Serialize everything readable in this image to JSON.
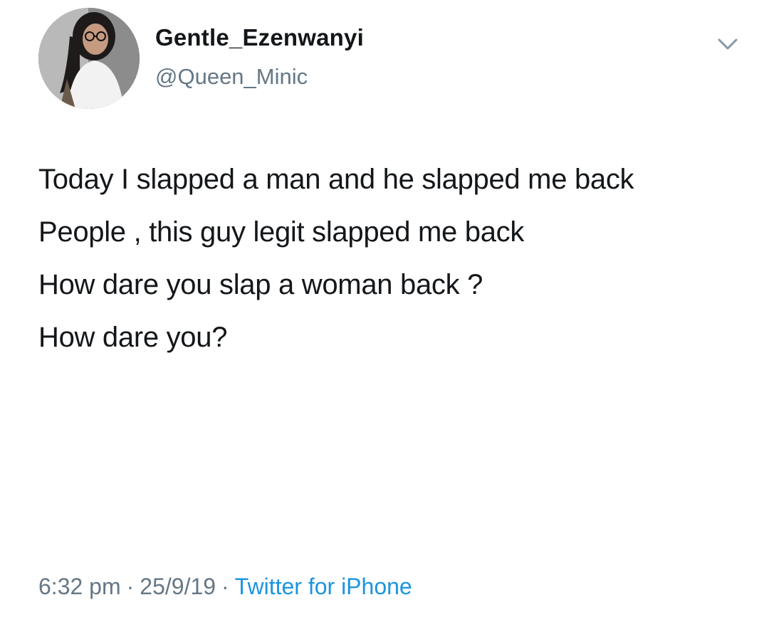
{
  "user": {
    "display_name": "Gentle_Ezenwanyi",
    "handle": "@Queen_Minic"
  },
  "tweet": {
    "paragraphs": [
      "Today I slapped a man and he slapped me back",
      "People , this guy legit slapped me back",
      "How dare you slap a woman back ?",
      "How dare you?"
    ],
    "time": "6:32 pm",
    "date": "25/9/19",
    "source": "Twitter for iPhone",
    "separator": "·"
  },
  "colors": {
    "text": "#14171a",
    "secondary": "#657786",
    "link": "#1b95e0"
  },
  "icons": {
    "menu": "chevron-down-icon"
  }
}
